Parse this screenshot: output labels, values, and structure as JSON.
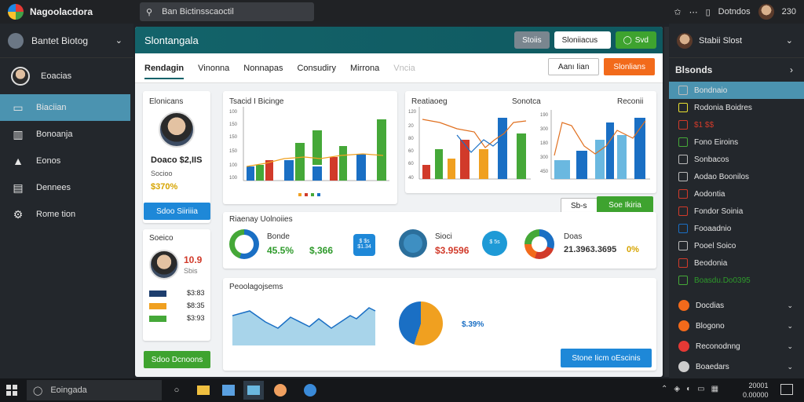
{
  "app": {
    "title": "Nagoolacdora",
    "search_text": "Ban Bictinsscaoctil",
    "user": "Dotndos",
    "time": "230"
  },
  "workspace": {
    "label": "Bantet Biotog"
  },
  "nav": {
    "user_label": "Eoacias",
    "items": [
      {
        "label": "Biaciian",
        "icon": "folder-icon"
      },
      {
        "label": "Bonoanja",
        "icon": "book-icon"
      },
      {
        "label": "Eonos",
        "icon": "warning-icon"
      },
      {
        "label": "Dennees",
        "icon": "document-icon"
      },
      {
        "label": "Rome tion",
        "icon": "gear-icon"
      }
    ]
  },
  "main": {
    "title": "Slontangala",
    "header_buttons": [
      "Stoiis",
      "Sloniiacus",
      "Svd"
    ],
    "tabs": [
      "Rendagin",
      "Vinonna",
      "Nonnapas",
      "Consudiry",
      "Mirrona",
      "Vncia"
    ],
    "tab_actions": [
      "Aanı Iian",
      "Slonlians"
    ],
    "profile_card": {
      "title": "Elonicans",
      "name": "Doaco $2,IIS",
      "sub": "Socioo",
      "value": "$370%",
      "button": "Sdoo Siiriiia"
    },
    "profile_card2": {
      "title": "Soeico",
      "value": "10.9",
      "sub": "Sbis",
      "rows": [
        "$3:83",
        "$8:35",
        "$3:93"
      ],
      "row_colors": [
        "#1d3e6e",
        "#f0a020",
        "#45a838"
      ]
    },
    "chart1": {
      "title": "Tsacid I Bicinge",
      "yticks": [
        "100",
        "150",
        "150",
        "150",
        "100",
        "100"
      ],
      "legend_colors": [
        "#f0a020",
        "#d13a2a",
        "#45a838",
        "#1a6fc4"
      ]
    },
    "chart2": {
      "title": "Reatiaoeg",
      "subtitle": "Sonotca",
      "right_title": "Reconii",
      "yticks": [
        "120",
        "20",
        "80",
        "60",
        "60",
        "40"
      ],
      "yticks2": [
        "190",
        "300",
        "180",
        "300",
        "450"
      ],
      "button_o": "Sb-s",
      "button_g": "Soe Ikiria"
    },
    "summary": {
      "title": "Riaenay Uolnoiies",
      "items": [
        {
          "label": "Bonde",
          "value": "45.5%",
          "value2": "$,366"
        },
        {
          "label": "Sioci",
          "value": "$3.9596"
        },
        {
          "label": "Doas",
          "value": "21.3963.3695",
          "value2": "0%"
        }
      ],
      "badge1": "$ $s $1.34",
      "badge2": "$ 5s"
    },
    "bottom": {
      "title": "Peoolagojsems",
      "pie_value": "$.39%",
      "button": "Stone Iicm oEscinis",
      "left_button": "Sdoo Dcnoons"
    }
  },
  "right_panel": {
    "user": "Stabii Slost",
    "section": "Blsonds",
    "items": [
      {
        "label": "Bondnaio",
        "color": "#cccccc"
      },
      {
        "label": "Rodonia Boidres",
        "color": "#e8e030"
      },
      {
        "label": "$1 $$",
        "color": "#d13a2a"
      },
      {
        "label": "Fono Eiroins",
        "color": "#45a838"
      },
      {
        "label": "Sonbacos",
        "color": "#cccccc"
      },
      {
        "label": "Aodao Boonilos",
        "color": "#cccccc"
      },
      {
        "label": "Aodontia",
        "color": "#d13a2a"
      },
      {
        "label": "Fondor Soinia",
        "color": "#d13a2a"
      },
      {
        "label": "Fooaadnio",
        "color": "#1a6fc4"
      },
      {
        "label": "Pooel Soico",
        "color": "#cccccc"
      },
      {
        "label": "Beodonia",
        "color": "#d13a2a"
      },
      {
        "label": "Boasdu.Do0395",
        "color": "#45a838"
      }
    ],
    "items2": [
      {
        "label": "Docdias",
        "color": "#f26a1b"
      },
      {
        "label": "Blogono",
        "color": "#f26a1b"
      },
      {
        "label": "Reconodnng",
        "color": "#e53935"
      },
      {
        "label": "Boaedars",
        "color": "#cccccc"
      }
    ]
  },
  "taskbar": {
    "search": "Eoingada",
    "date": "20001",
    "time": "0.00000"
  }
}
